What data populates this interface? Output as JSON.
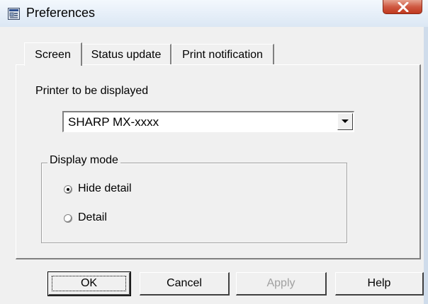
{
  "window": {
    "title": "Preferences"
  },
  "tabs": [
    {
      "label": "Screen",
      "active": true
    },
    {
      "label": "Status update",
      "active": false
    },
    {
      "label": "Print notification",
      "active": false
    }
  ],
  "printer": {
    "label": "Printer to be displayed",
    "selected": "SHARP MX-xxxx"
  },
  "display_mode": {
    "label": "Display mode",
    "options": [
      {
        "label": "Hide detail",
        "checked": true
      },
      {
        "label": "Detail",
        "checked": false
      }
    ]
  },
  "buttons": {
    "ok": "OK",
    "cancel": "Cancel",
    "apply": "Apply",
    "help": "Help"
  },
  "icons": {
    "app": "printer-monitor-icon",
    "close": "close-icon",
    "dropdown": "chevron-down-icon"
  },
  "colors": {
    "close_button": "#c8462c",
    "dialog_face": "#f0f0f0",
    "title_bar": "#dbe7f4"
  }
}
